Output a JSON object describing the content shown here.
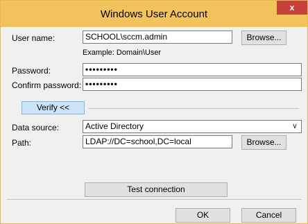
{
  "window": {
    "title": "Windows User Account",
    "close_label": "x"
  },
  "form": {
    "user_name": {
      "label": "User name:",
      "value": "SCHOOL\\sccm.admin",
      "browse_label": "Browse...",
      "example": "Example: Domain\\User"
    },
    "password": {
      "label": "Password:",
      "value": "•••••••••"
    },
    "confirm_password": {
      "label": "Confirm password:",
      "value": "•••••••••"
    },
    "verify_label": "Verify <<",
    "data_source": {
      "label": "Data source:",
      "value": "Active Directory"
    },
    "path": {
      "label": "Path:",
      "value": "LDAP://DC=school,DC=local",
      "browse_label": "Browse..."
    },
    "test_connection_label": "Test connection"
  },
  "footer": {
    "ok_label": "OK",
    "cancel_label": "Cancel"
  },
  "icons": {
    "dropdown": "chevron-down-icon"
  },
  "colors": {
    "titlebar": "#f3c35b",
    "close": "#c7413c",
    "accent_button": "#cce4f7"
  }
}
